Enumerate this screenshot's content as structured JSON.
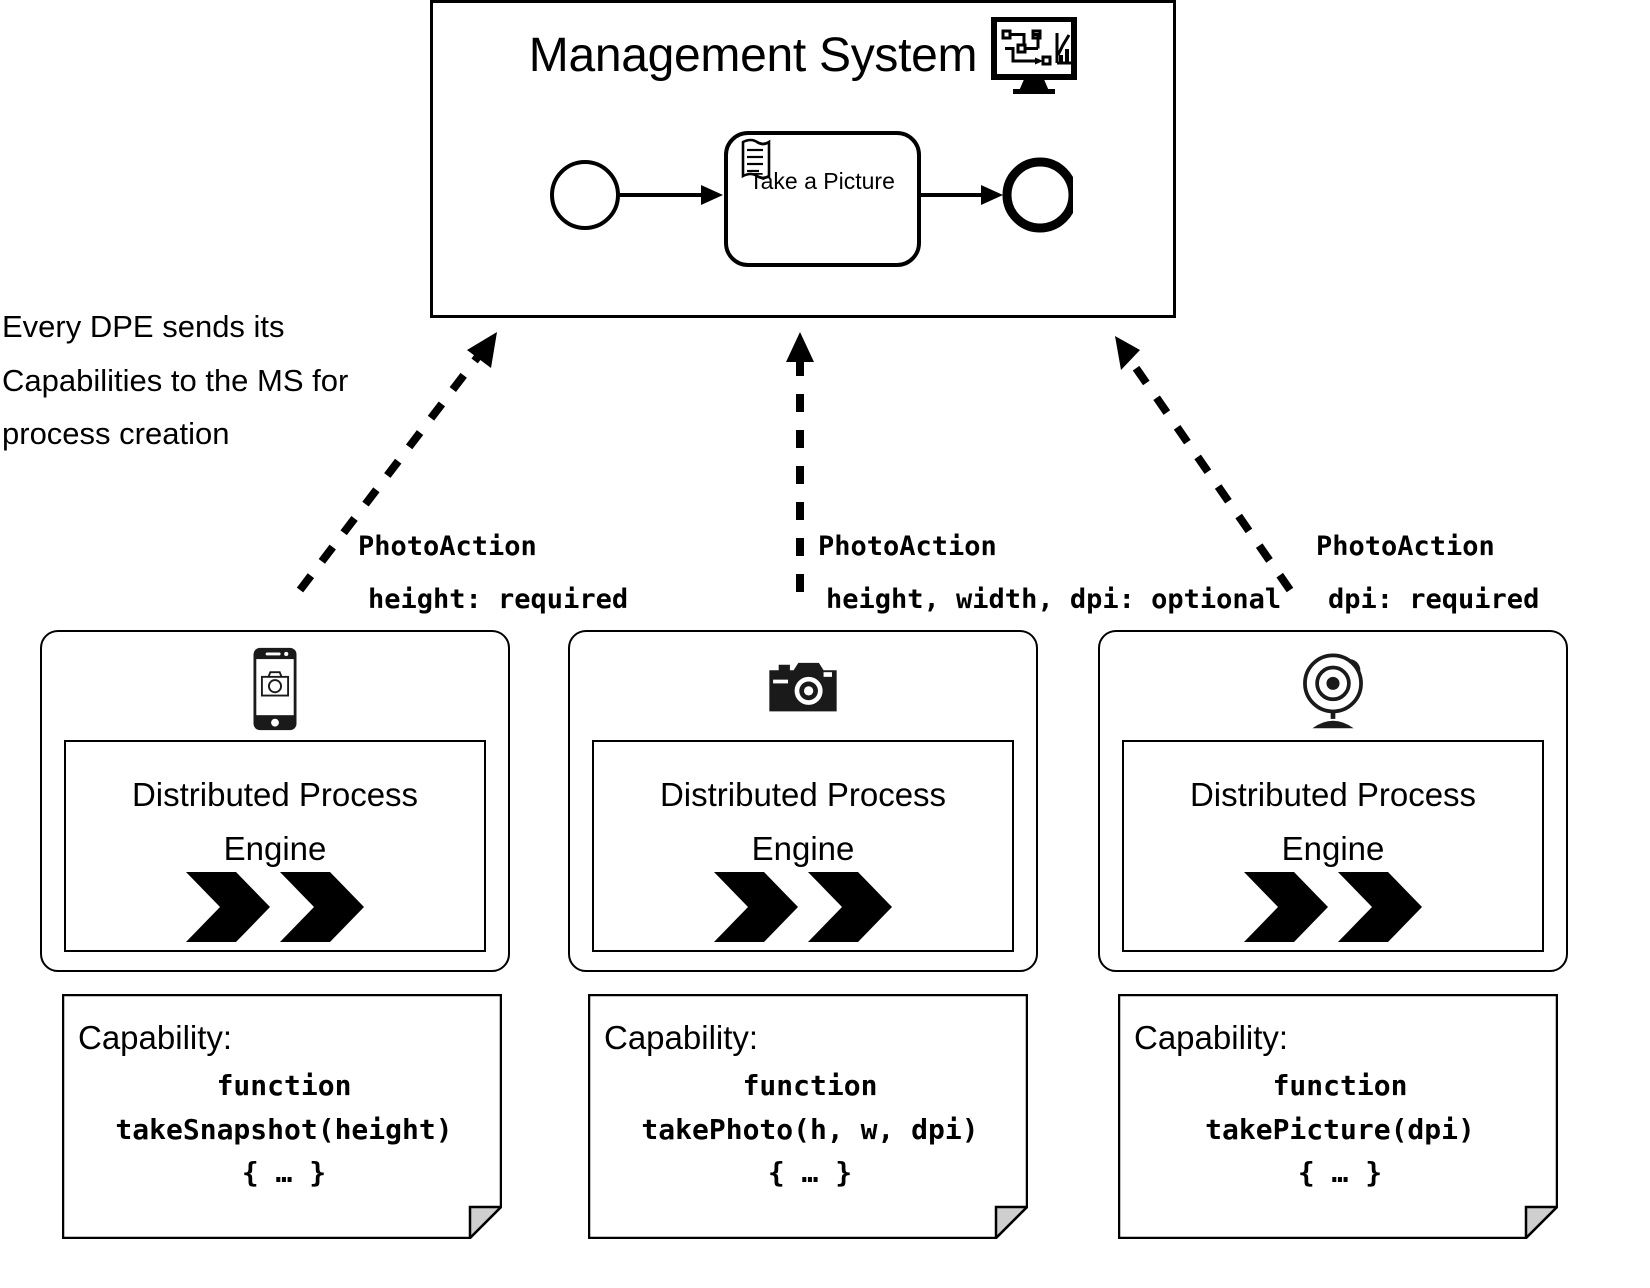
{
  "diagram": {
    "title": "Management System capability registration"
  },
  "management_system": {
    "title": "Management System",
    "icon": "management-system-monitor-icon",
    "process": {
      "start_event": "start-event",
      "task": {
        "label": "Take a Picture",
        "icon": "script-task-icon"
      },
      "end_event": "end-event"
    }
  },
  "annotation": {
    "text": "Every DPE sends its Capabilities to the MS for process creation"
  },
  "capabilities_labels": [
    {
      "title": "PhotoAction",
      "params": "height: required"
    },
    {
      "title": "PhotoAction",
      "params": "height, width, dpi: optional"
    },
    {
      "title": "PhotoAction",
      "params": "dpi: required"
    }
  ],
  "engines": [
    {
      "device_icon": "smartphone-camera-icon",
      "label_line1": "Distributed Process",
      "label_line2": "Engine"
    },
    {
      "device_icon": "dslr-camera-icon",
      "label_line1": "Distributed Process",
      "label_line2": "Engine"
    },
    {
      "device_icon": "webcam-icon",
      "label_line1": "Distributed Process",
      "label_line2": "Engine"
    }
  ],
  "capability_notes": [
    {
      "heading": "Capability:",
      "code_line1": "function",
      "code_line2": "takeSnapshot(height)",
      "code_line3": "{ … }"
    },
    {
      "heading": "Capability:",
      "code_line1": "function",
      "code_line2": "takePhoto(h, w, dpi)",
      "code_line3": "{ … }"
    },
    {
      "heading": "Capability:",
      "code_line1": "function",
      "code_line2": "takePicture(dpi)",
      "code_line3": "{ … }"
    }
  ],
  "colors": {
    "stroke": "#000000",
    "background": "#ffffff",
    "note_fold": "#cccccc"
  }
}
